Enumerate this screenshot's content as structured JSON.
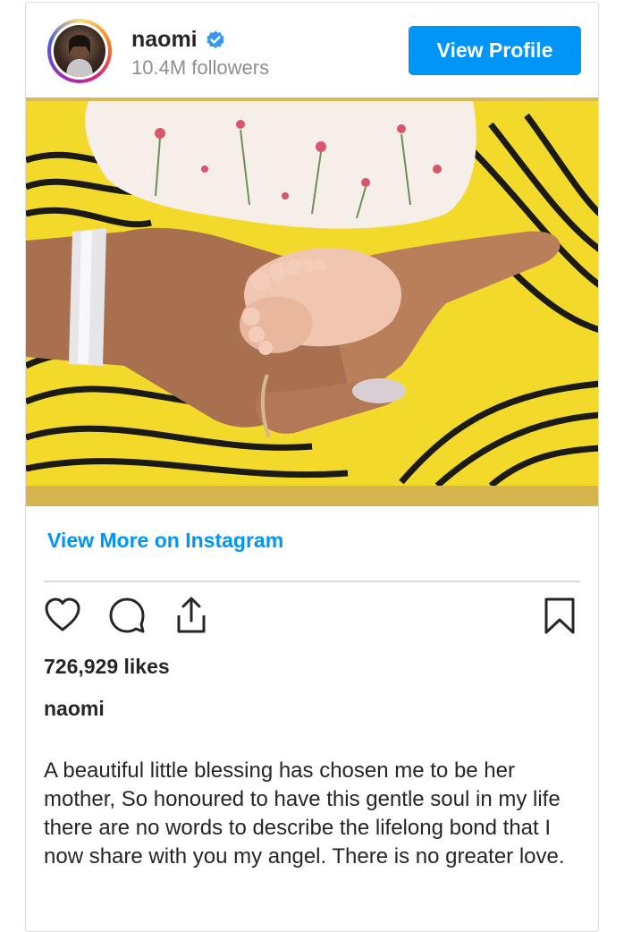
{
  "header": {
    "username": "naomi",
    "followers": "10.4M followers",
    "view_profile_label": "View Profile"
  },
  "photo": {
    "subject": "baby-feet-in-hand"
  },
  "links": {
    "view_more": "View More on Instagram"
  },
  "actions": {
    "icons": [
      "heart-icon",
      "comment-icon",
      "share-icon",
      "bookmark-icon"
    ]
  },
  "post": {
    "likes": "726,929 likes",
    "caption_username": "naomi",
    "caption": "A beautiful little blessing has chosen me to be her mother, So honoured to have this gentle soul in my life there are no words to describe the lifelong bond that I now share with you my angel. There is no greater love."
  },
  "colors": {
    "accent": "#0095f6",
    "text": "#262626",
    "muted": "#8e8e8e",
    "border": "#dbdbdb"
  }
}
